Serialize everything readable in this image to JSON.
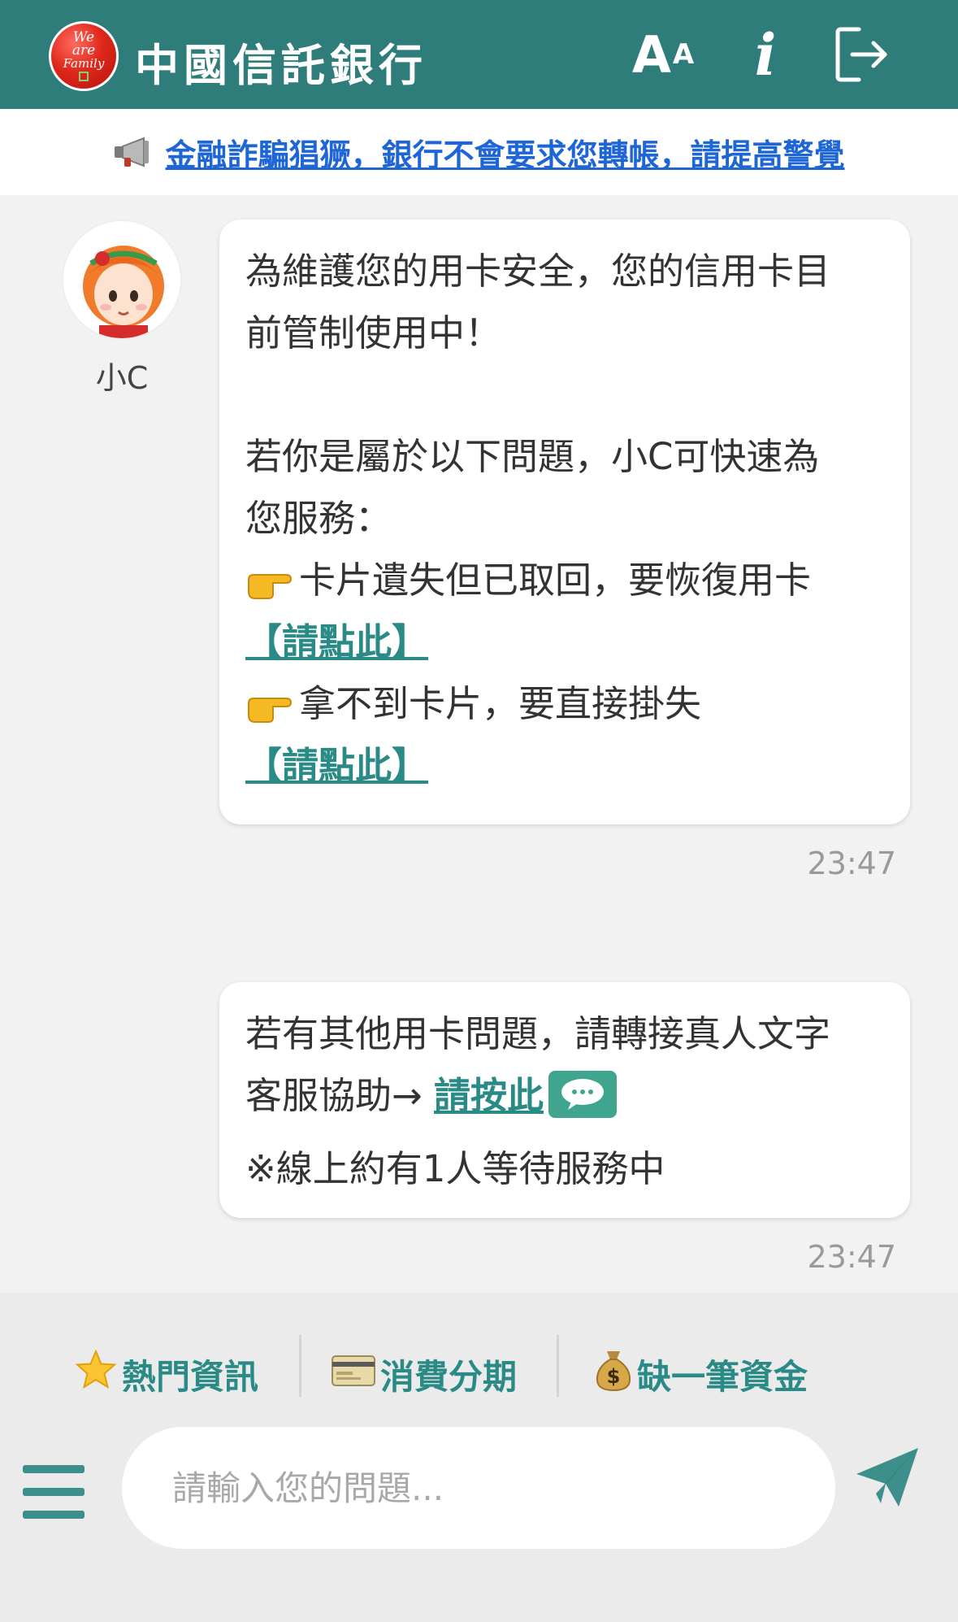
{
  "header": {
    "logo_text": "We are Family",
    "title": "中國信託銀行",
    "fontsize_label": "A",
    "fontsize_sup": "A",
    "info_label": "i",
    "accent": "#2e7d7a"
  },
  "notice": {
    "text": "金融詐騙猖獗，銀行不會要求您轉帳，請提高警覺",
    "color": "#1e66d6"
  },
  "bot": {
    "name": "小C"
  },
  "messages": [
    {
      "line1": "為維護您的用卡安全，您的信用卡目",
      "line2": "前管制使用中！",
      "line3": "若你是屬於以下問題，小C可快速為",
      "line4": "您服務：",
      "option1": "卡片遺失但已取回，要恢復用卡",
      "option1_link": "【請點此】",
      "option2": "拿不到卡片，要直接掛失",
      "option2_link": "【請點此】",
      "time": "23:47"
    },
    {
      "line1": "若有其他用卡問題，請轉接真人文字",
      "line2": "客服協助→ ",
      "link": "請按此",
      "line3": "※線上約有1人等待服務中",
      "time": "23:47"
    }
  ],
  "quick_menu": [
    {
      "label": "熱門資訊",
      "icon": "star-icon"
    },
    {
      "label": "消費分期",
      "icon": "credit-card-icon"
    },
    {
      "label": "缺一筆資金",
      "icon": "money-bag-icon"
    }
  ],
  "input": {
    "placeholder": "請輸入您的問題..."
  }
}
